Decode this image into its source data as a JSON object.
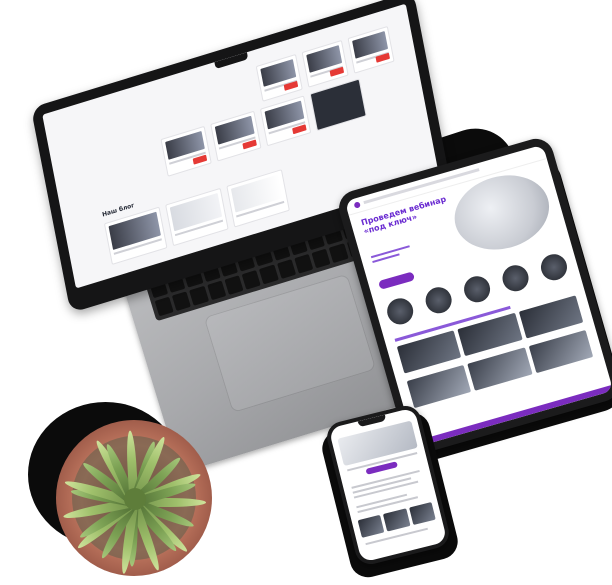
{
  "scene": {
    "description_tag": "device mockup",
    "colors": {
      "accent_purple": "#7b2cbf",
      "price_red": "#e53935",
      "laptop_silver": "#b0b1b4",
      "plant_green": "#7ca154",
      "pot_terracotta": "#b7705a"
    }
  },
  "laptop": {
    "screen_heading": "Наш блог",
    "icons": [
      "laptop-icon"
    ]
  },
  "tablet": {
    "hero_title": "Проведем вебинар «под ключ»",
    "icons": [
      "tablet-icon"
    ]
  },
  "phone": {
    "icons": [
      "phone-icon"
    ]
  }
}
